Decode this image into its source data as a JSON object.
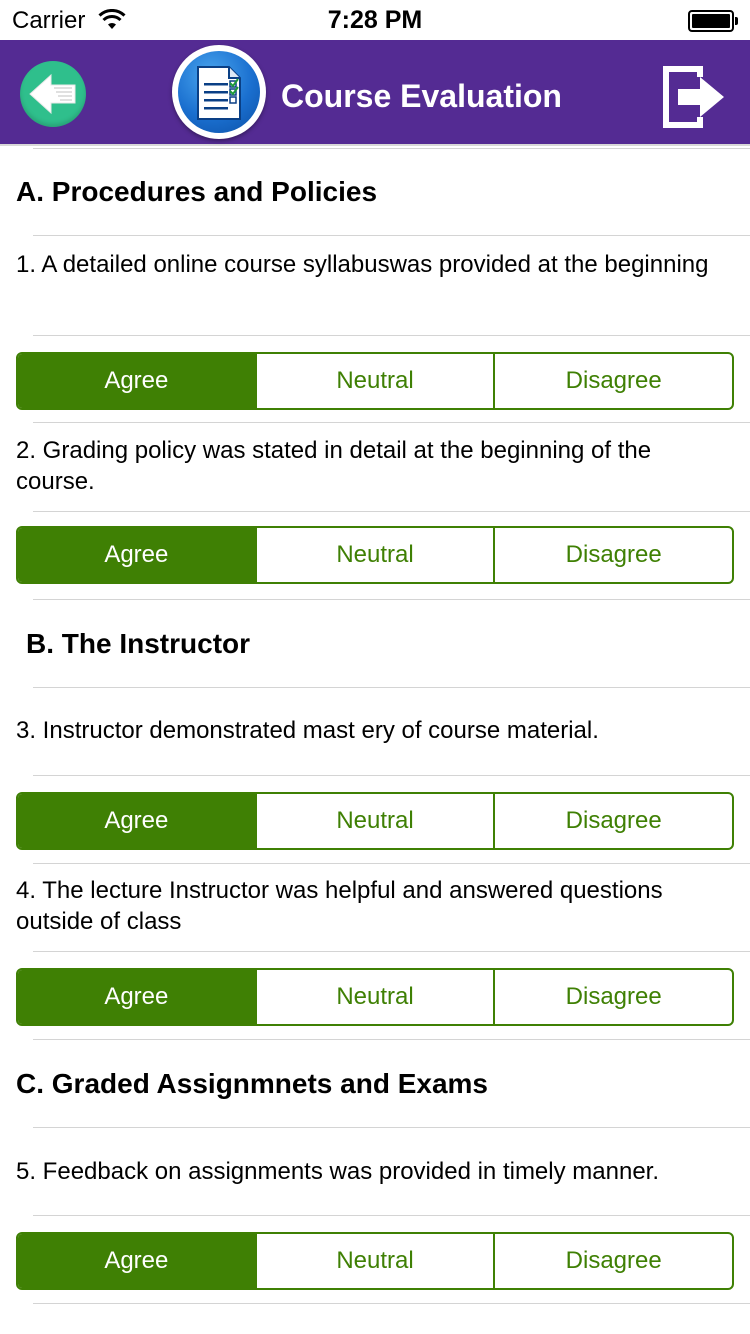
{
  "status_bar": {
    "carrier": "Carrier",
    "time": "7:28 PM"
  },
  "nav": {
    "title": "Course Evaluation",
    "back_icon": "back-arrow-icon",
    "logout_icon": "logout-icon"
  },
  "sections": {
    "a": "A. Procedures and Policies",
    "b": "B. The Instructor",
    "c": "C. Graded Assignmnets and Exams"
  },
  "questions": [
    {
      "text": "1. A detailed online course syllabuswas provided at the beginning",
      "selected": "Agree"
    },
    {
      "text": "2. Grading policy was stated in detail at the beginning of the course.",
      "selected": "Agree"
    },
    {
      "text": "3. Instructor demonstrated mast ery of course material.",
      "selected": "Agree"
    },
    {
      "text": "4. The lecture Instructor was helpful and answered questions outside of class",
      "selected": "Agree"
    },
    {
      "text": "5. Feedback on assignments was provided in timely manner.",
      "selected": "Agree"
    }
  ],
  "options": [
    "Agree",
    "Neutral",
    "Disagree"
  ],
  "colors": {
    "nav": "#542b93",
    "accent": "#3f8004",
    "back_button": "#2fbf8c"
  }
}
